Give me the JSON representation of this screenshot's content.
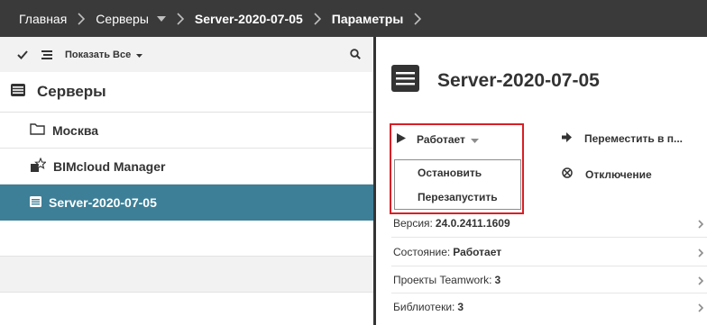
{
  "breadcrumb": {
    "home": "Главная",
    "servers": "Серверы",
    "server": "Server-2020-07-05",
    "params": "Параметры"
  },
  "toolbar": {
    "show_all": "Показать Все"
  },
  "tree": {
    "header": "Серверы",
    "items": [
      {
        "label": "Москва",
        "icon": "folder-icon"
      },
      {
        "label": "BIMcloud Manager",
        "icon": "manager-icon"
      },
      {
        "label": "Server-2020-07-05",
        "icon": "server-icon",
        "selected": true
      }
    ]
  },
  "server": {
    "name": "Server-2020-07-05",
    "status_button": "Работает",
    "menu": [
      "Остановить",
      "Перезапустить"
    ],
    "actions": [
      "Переместить в п...",
      "Отключение"
    ],
    "info": [
      {
        "label": "Версия:",
        "value": "24.0.2411.1609"
      },
      {
        "label": "Состояние:",
        "value": "Работает"
      },
      {
        "label": "Проекты Teamwork:",
        "value": "3"
      },
      {
        "label": "Библиотеки:",
        "value": "3"
      }
    ]
  },
  "colors": {
    "topbar": "#3a3a3a",
    "selected": "#3d7f97",
    "highlight_border": "#d81f26"
  }
}
